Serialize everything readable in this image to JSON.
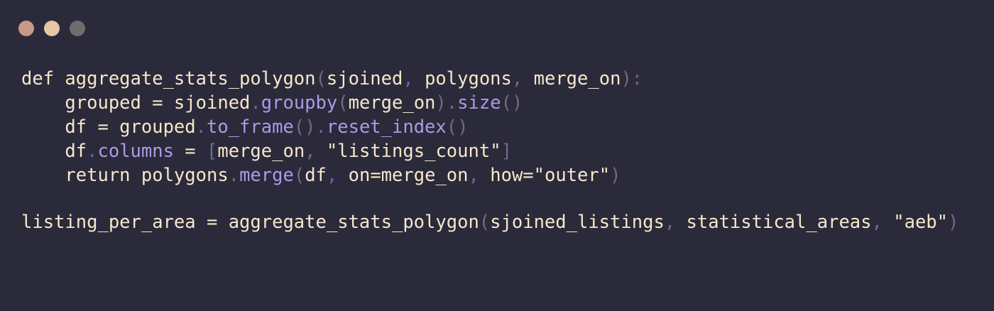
{
  "window": {
    "background": "#2b2a3a",
    "traffic_lights": [
      {
        "name": "close",
        "color": "#c79a86"
      },
      {
        "name": "minimize",
        "color": "#e6c6a5"
      },
      {
        "name": "maximize",
        "color": "#6e6e6e"
      }
    ]
  },
  "colors": {
    "text": "#f6e7cc",
    "method": "#a99be8",
    "punct": "#6f6b85"
  },
  "code": {
    "lines": [
      [
        {
          "t": "def aggregate_stats_polygon",
          "c": "plain"
        },
        {
          "t": "(",
          "c": "punct"
        },
        {
          "t": "sjoined",
          "c": "plain"
        },
        {
          "t": ", ",
          "c": "punct"
        },
        {
          "t": "polygons",
          "c": "plain"
        },
        {
          "t": ", ",
          "c": "punct"
        },
        {
          "t": "merge_on",
          "c": "plain"
        },
        {
          "t": "):",
          "c": "punct"
        }
      ],
      [
        {
          "t": "    grouped = sjoined",
          "c": "plain"
        },
        {
          "t": ".",
          "c": "punct"
        },
        {
          "t": "groupby",
          "c": "method"
        },
        {
          "t": "(",
          "c": "punct"
        },
        {
          "t": "merge_on",
          "c": "plain"
        },
        {
          "t": ").",
          "c": "punct"
        },
        {
          "t": "size",
          "c": "method"
        },
        {
          "t": "()",
          "c": "punct"
        }
      ],
      [
        {
          "t": "    df = grouped",
          "c": "plain"
        },
        {
          "t": ".",
          "c": "punct"
        },
        {
          "t": "to_frame",
          "c": "method"
        },
        {
          "t": "().",
          "c": "punct"
        },
        {
          "t": "reset_index",
          "c": "method"
        },
        {
          "t": "()",
          "c": "punct"
        }
      ],
      [
        {
          "t": "    df",
          "c": "plain"
        },
        {
          "t": ".",
          "c": "punct"
        },
        {
          "t": "columns",
          "c": "method"
        },
        {
          "t": " = ",
          "c": "plain"
        },
        {
          "t": "[",
          "c": "punct"
        },
        {
          "t": "merge_on",
          "c": "plain"
        },
        {
          "t": ", ",
          "c": "punct"
        },
        {
          "t": "\"listings_count\"",
          "c": "plain"
        },
        {
          "t": "]",
          "c": "punct"
        }
      ],
      [
        {
          "t": "    return polygons",
          "c": "plain"
        },
        {
          "t": ".",
          "c": "punct"
        },
        {
          "t": "merge",
          "c": "method"
        },
        {
          "t": "(",
          "c": "punct"
        },
        {
          "t": "df",
          "c": "plain"
        },
        {
          "t": ", ",
          "c": "punct"
        },
        {
          "t": "on=merge_on",
          "c": "plain"
        },
        {
          "t": ", ",
          "c": "punct"
        },
        {
          "t": "how=\"outer\"",
          "c": "plain"
        },
        {
          "t": ")",
          "c": "punct"
        }
      ],
      [],
      [
        {
          "t": "listing_per_area = aggregate_stats_polygon",
          "c": "plain"
        },
        {
          "t": "(",
          "c": "punct"
        },
        {
          "t": "sjoined_listings",
          "c": "plain"
        },
        {
          "t": ", ",
          "c": "punct"
        },
        {
          "t": "statistical_areas",
          "c": "plain"
        },
        {
          "t": ", ",
          "c": "punct"
        },
        {
          "t": "\"aeb\"",
          "c": "plain"
        },
        {
          "t": ")",
          "c": "punct"
        }
      ]
    ]
  }
}
